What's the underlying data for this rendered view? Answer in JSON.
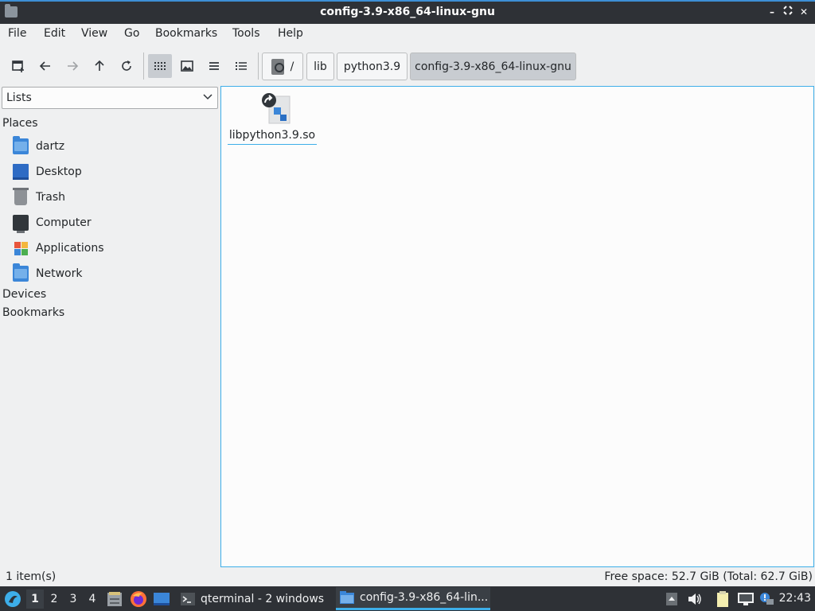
{
  "window": {
    "title": "config-3.9-x86_64-linux-gnu",
    "minimize": "–",
    "maximize": "⛶",
    "close": "✕"
  },
  "menu": [
    "File",
    "Edit",
    "View",
    "Go",
    "Bookmarks",
    "Tools",
    "Help"
  ],
  "toolbar": {
    "icons": [
      "new-tab-icon",
      "back-arrow-icon",
      "forward-arrow-icon",
      "up-arrow-icon",
      "reload-icon",
      "icon-view-icon",
      "thumbnail-view-icon",
      "compact-view-icon",
      "detailed-list-icon"
    ],
    "active_view": "icon-view"
  },
  "breadcrumb": {
    "root": "/",
    "parts": [
      "lib",
      "python3.9",
      "config-3.9-x86_64-linux-gnu"
    ]
  },
  "sidebar": {
    "mode": "Lists",
    "places_label": "Places",
    "places": [
      {
        "label": "dartz",
        "icon": "home-folder-icon"
      },
      {
        "label": "Desktop",
        "icon": "desktop-icon"
      },
      {
        "label": "Trash",
        "icon": "trash-icon"
      },
      {
        "label": "Computer",
        "icon": "computer-icon"
      },
      {
        "label": "Applications",
        "icon": "applications-icon"
      },
      {
        "label": "Network",
        "icon": "network-folder-icon"
      }
    ],
    "devices_label": "Devices",
    "bookmarks_label": "Bookmarks"
  },
  "files": [
    {
      "name": "libpython3.9.so",
      "icon": "symlink-library-icon"
    }
  ],
  "status": {
    "items": "1 item(s)",
    "free_space": "Free space: 52.7 GiB (Total: 62.7 GiB)"
  },
  "taskbar": {
    "desktops": [
      "1",
      "2",
      "3",
      "4"
    ],
    "active_desktop": "1",
    "tasks": [
      {
        "label": "qterminal - 2 windows",
        "icon": "terminal-icon"
      },
      {
        "label": "config-3.9-x86_64-lin...",
        "icon": "folder-icon"
      }
    ],
    "clock": "22:43"
  },
  "colors": {
    "accent": "#3daee9",
    "titlebar": "#2e3136",
    "folder_blue": "#3b86d8"
  }
}
